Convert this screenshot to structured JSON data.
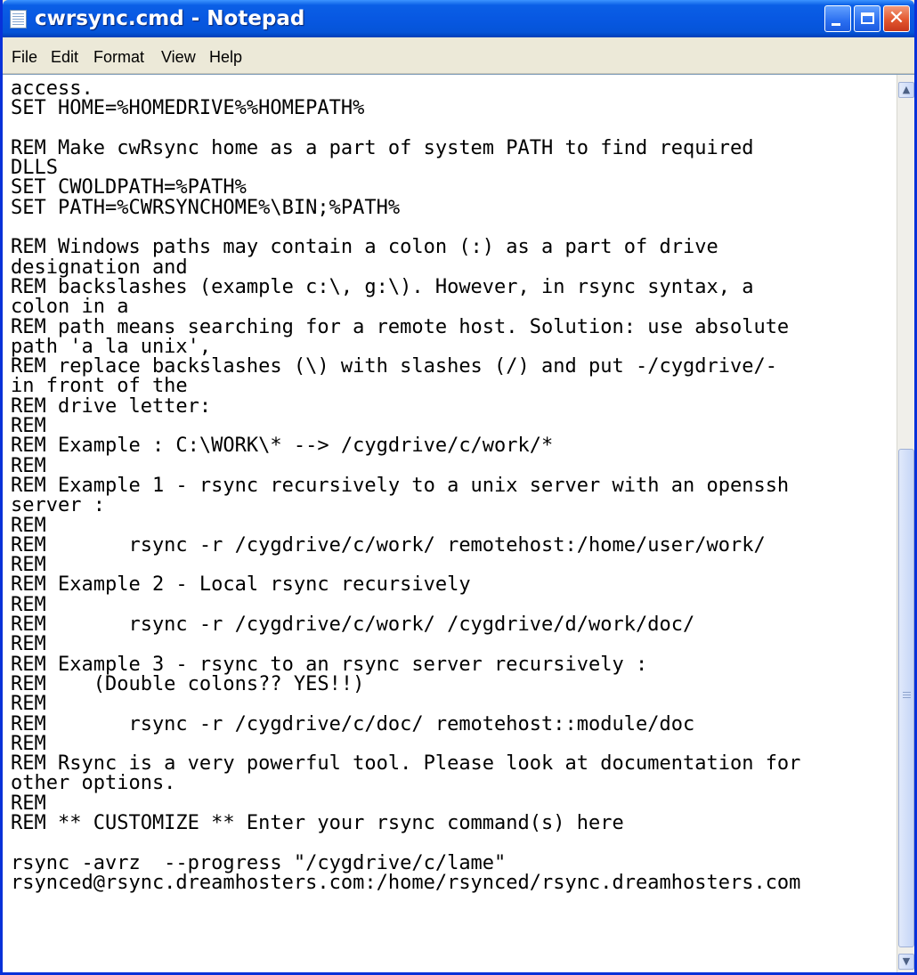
{
  "window": {
    "title": "cwrsync.cmd - Notepad",
    "caption_buttons": {
      "minimize": "minimize",
      "maximize": "maximize",
      "close": "✕"
    }
  },
  "menu": [
    "File",
    "Edit",
    "Format",
    "View",
    "Help"
  ],
  "editor": {
    "content": "access.\nSET HOME=%HOMEDRIVE%%HOMEPATH%\n\nREM Make cwRsync home as a part of system PATH to find required\nDLLS\nSET CWOLDPATH=%PATH%\nSET PATH=%CWRSYNCHOME%\\BIN;%PATH%\n\nREM Windows paths may contain a colon (:) as a part of drive\ndesignation and\nREM backslashes (example c:\\, g:\\). However, in rsync syntax, a\ncolon in a\nREM path means searching for a remote host. Solution: use absolute\npath 'a la unix',\nREM replace backslashes (\\) with slashes (/) and put -/cygdrive/-\nin front of the\nREM drive letter:\nREM\nREM Example : C:\\WORK\\* --> /cygdrive/c/work/*\nREM\nREM Example 1 - rsync recursively to a unix server with an openssh\nserver :\nREM\nREM       rsync -r /cygdrive/c/work/ remotehost:/home/user/work/\nREM\nREM Example 2 - Local rsync recursively\nREM\nREM       rsync -r /cygdrive/c/work/ /cygdrive/d/work/doc/\nREM\nREM Example 3 - rsync to an rsync server recursively :\nREM    (Double colons?? YES!!)\nREM\nREM       rsync -r /cygdrive/c/doc/ remotehost::module/doc\nREM\nREM Rsync is a very powerful tool. Please look at documentation for\nother options.\nREM\nREM ** CUSTOMIZE ** Enter your rsync command(s) here\n\nrsync -avrz  --progress \"/cygdrive/c/lame\"\nrsynced@rsync.dreamhosters.com:/home/rsynced/rsync.dreamhosters.com"
  },
  "colors": {
    "titlebar": "#0858e2",
    "window_border": "#0831d9",
    "menu_background": "#ece9d8",
    "editor_background": "#ffffff",
    "close_button": "#e2572f"
  },
  "icons": {
    "app": "notepad-icon",
    "scroll_up": "scroll-up-arrow-icon",
    "scroll_down": "scroll-down-arrow-icon"
  }
}
